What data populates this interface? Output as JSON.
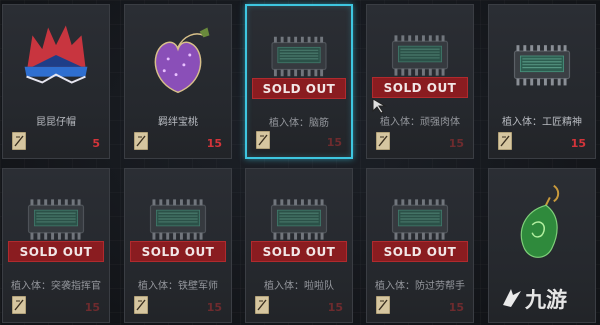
{
  "shop": {
    "currency_icon": "ticket-icon",
    "accent_color": "#3ec6e0",
    "price_color": "#d3343a",
    "items": [
      {
        "name": "昆昆仔帽",
        "price": "5",
        "sold_label": "",
        "icon": "spiky-hat-icon"
      },
      {
        "name": "羁绊宝桃",
        "price": "15",
        "sold_label": "",
        "icon": "purple-peach-icon"
      },
      {
        "name": "植入体：脑筋",
        "price": "15",
        "sold_label": "SOLD OUT",
        "icon": "chip-icon"
      },
      {
        "name": "植入体：顽强肉体",
        "price": "15",
        "sold_label": "SOLD OUT",
        "icon": "chip-icon"
      },
      {
        "name": "植入体：工匠精神",
        "price": "15",
        "sold_label": "",
        "icon": "chip-icon"
      },
      {
        "name": "植入体：突袭指挥官",
        "price": "15",
        "sold_label": "SOLD OUT",
        "icon": "chip-icon"
      },
      {
        "name": "植入体：铁壁军师",
        "price": "15",
        "sold_label": "SOLD OUT",
        "icon": "chip-icon"
      },
      {
        "name": "植入体：啦啦队",
        "price": "15",
        "sold_label": "SOLD OUT",
        "icon": "chip-icon"
      },
      {
        "name": "植入体：防过劳帮手",
        "price": "15",
        "sold_label": "SOLD OUT",
        "icon": "chip-icon"
      },
      {
        "name": "",
        "price": "",
        "sold_label": "",
        "icon": "green-jade-pendant-icon"
      }
    ]
  },
  "watermark": {
    "text": "九游"
  }
}
